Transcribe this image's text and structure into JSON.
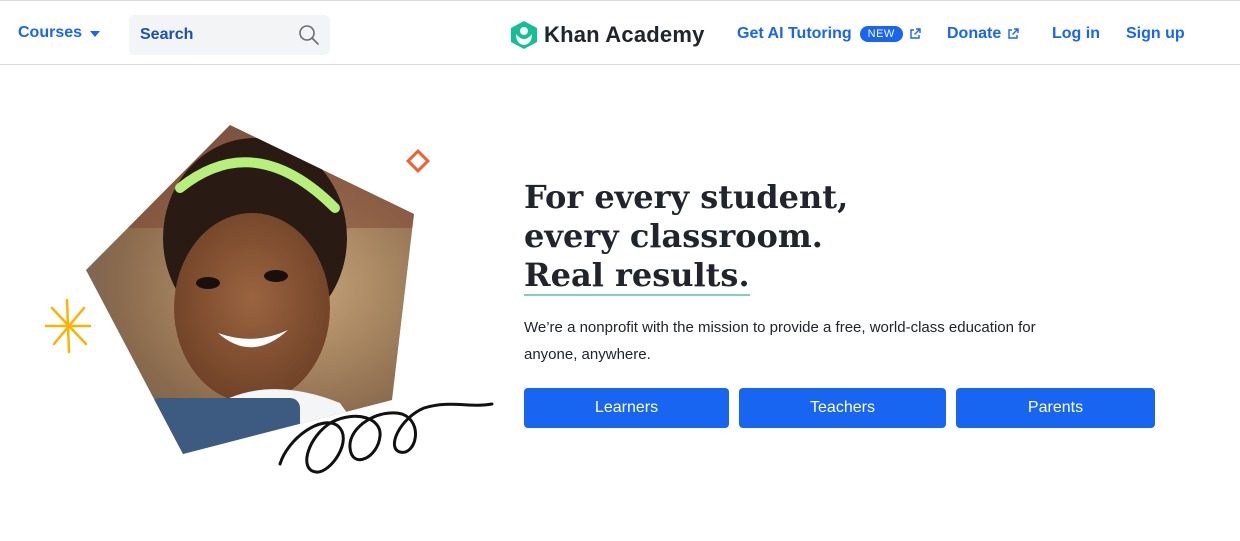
{
  "header": {
    "courses_label": "Courses",
    "search_placeholder": "Search",
    "logo_text": "Khan Academy",
    "ai_tutoring_label": "Get AI Tutoring",
    "new_badge": "NEW",
    "donate_label": "Donate",
    "login_label": "Log in",
    "signup_label": "Sign up"
  },
  "hero": {
    "headline_line1": "For every student,",
    "headline_line2": "every classroom.",
    "headline_line3": "Real results.",
    "description": "We’re a nonprofit with the mission to provide a free, world-class education for anyone, anywhere.",
    "buttons": [
      "Learners",
      "Teachers",
      "Parents"
    ]
  },
  "icons": {
    "caret": "chevron-down-icon",
    "search": "search-icon",
    "logo": "khan-academy-hexagon-logo",
    "external": "external-link-icon"
  },
  "colors": {
    "accent": "#1865f2",
    "logo_green": "#14bf96",
    "underline_mint": "#7fd1b9",
    "sparkle_yellow": "#ffb100",
    "diamond_orange": "#f2602f"
  }
}
